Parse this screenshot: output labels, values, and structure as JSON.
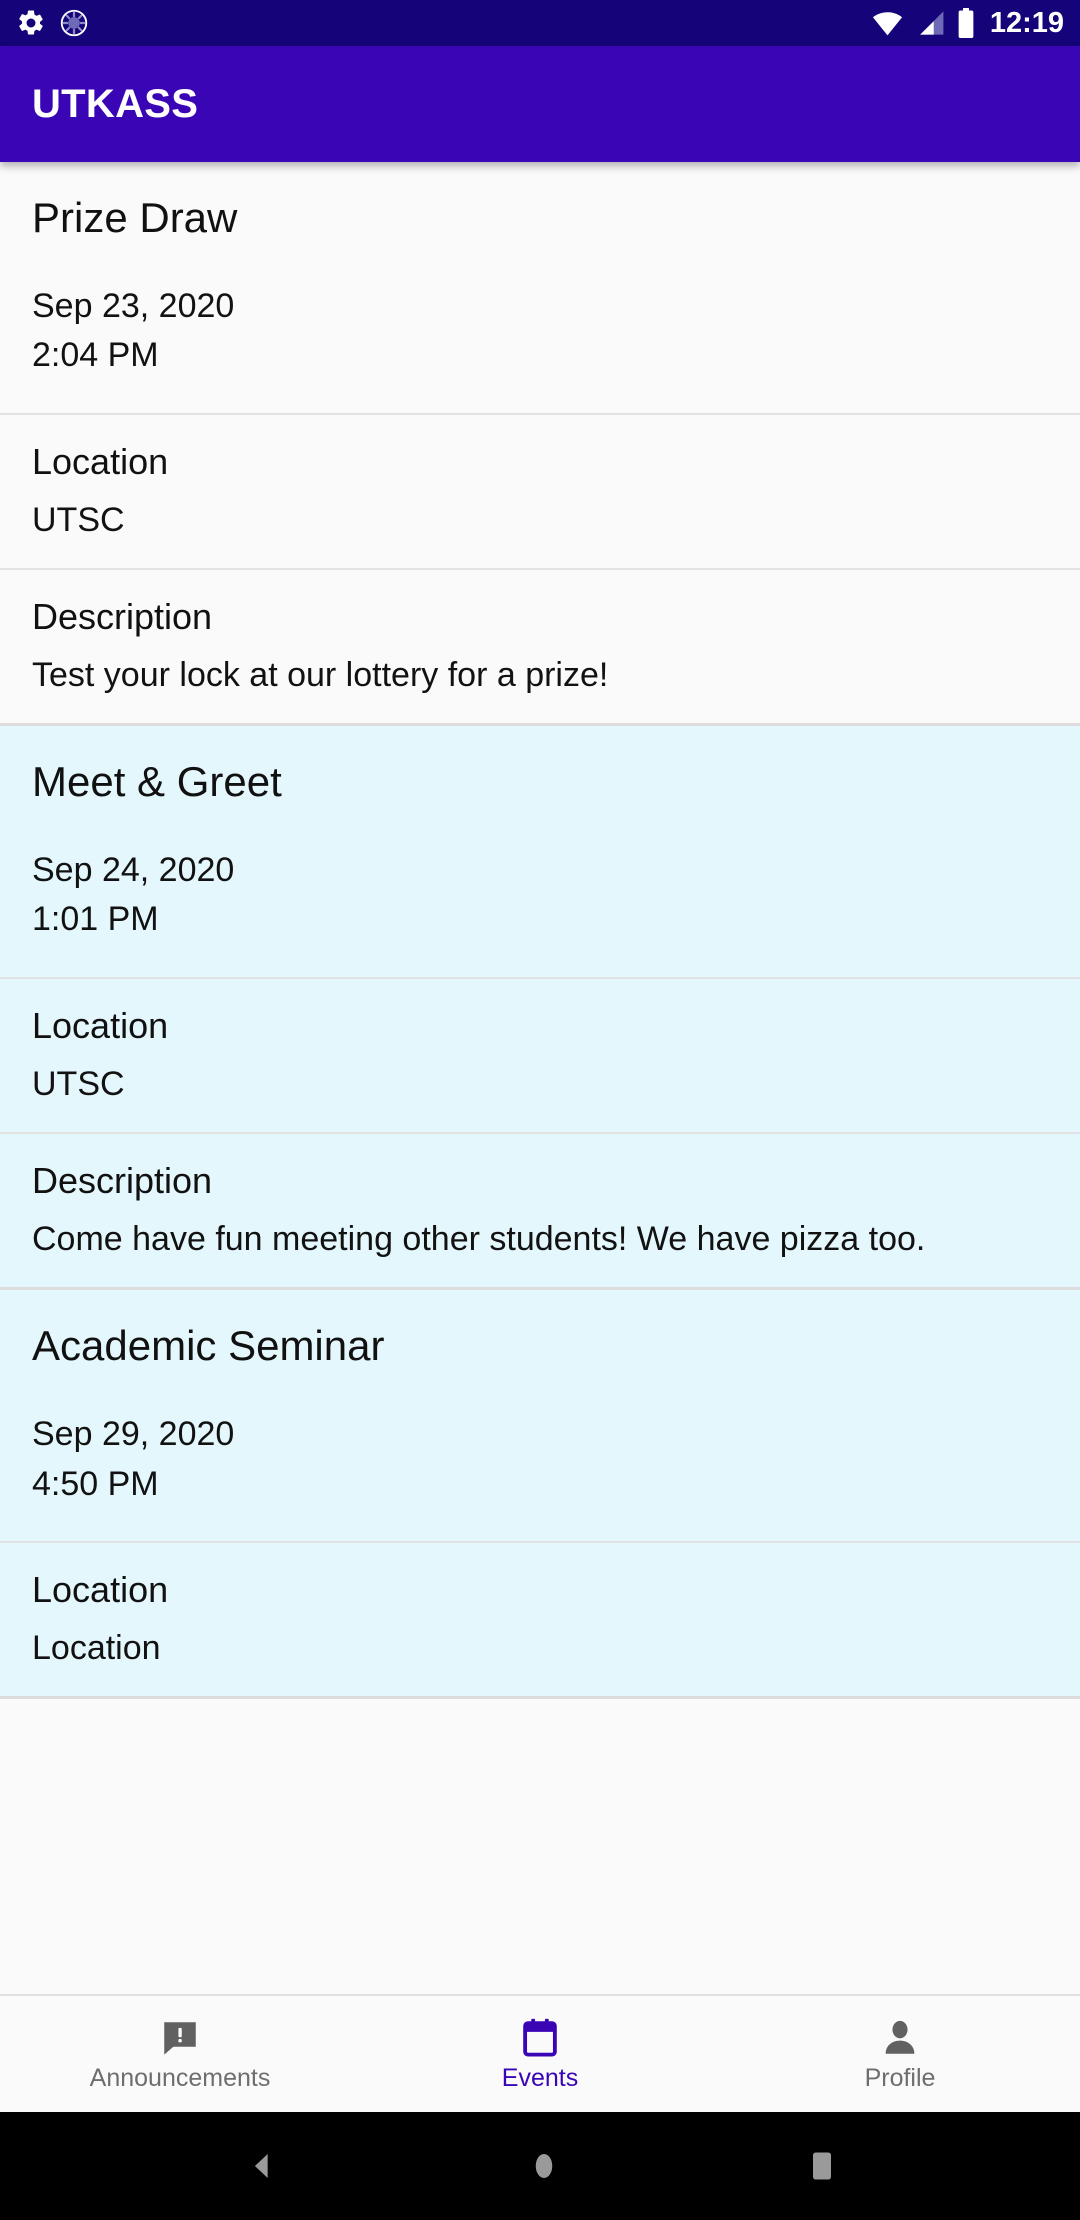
{
  "status_bar": {
    "left_icons": [
      "settings-gear-icon",
      "sync-progress-icon"
    ],
    "right_icons": [
      "wifi-icon",
      "cell-signal-icon",
      "battery-icon"
    ],
    "time": "12:19",
    "background_color": "#150479"
  },
  "app_bar": {
    "title": "UTKASS",
    "background_color": "#3a05b5",
    "text_color": "#ffffff"
  },
  "labels": {
    "location": "Location",
    "description": "Description"
  },
  "events": [
    {
      "title": "Prize Draw",
      "date": "Sep 23, 2020",
      "time": "2:04 PM",
      "location": "UTSC",
      "description": "Test your lock at our lottery for a prize!",
      "background_color": "#fafafa"
    },
    {
      "title": "Meet & Greet",
      "date": "Sep 24, 2020",
      "time": "1:01 PM",
      "location": "UTSC",
      "description": "Come have fun meeting other students! We have pizza too.",
      "background_color": "#e4f7fc"
    },
    {
      "title": "Academic Seminar",
      "date": "Sep 29, 2020",
      "time": "4:50 PM",
      "location": "Location",
      "description": "",
      "background_color": "#e4f7fc"
    }
  ],
  "bottom_nav": {
    "active_color": "#3a05b5",
    "inactive_color": "#6e6e6e",
    "items": [
      {
        "label": "Announcements",
        "icon": "announcement-icon",
        "active": false
      },
      {
        "label": "Events",
        "icon": "calendar-icon",
        "active": true
      },
      {
        "label": "Profile",
        "icon": "person-icon",
        "active": false
      }
    ]
  },
  "system_nav": {
    "buttons": [
      "back-button",
      "home-button",
      "recents-button"
    ],
    "background_color": "#000000"
  }
}
